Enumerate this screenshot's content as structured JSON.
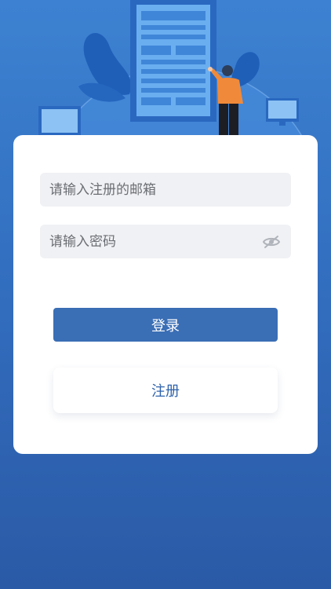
{
  "login_form": {
    "email": {
      "placeholder": "请输入注册的邮箱",
      "value": ""
    },
    "password": {
      "placeholder": "请输入密码",
      "value": "",
      "toggle_icon": "eye-off-icon"
    },
    "login_label": "登录",
    "register_label": "注册"
  },
  "colors": {
    "background_top": "#3d82d2",
    "background_bottom": "#2a5aa6",
    "primary_button": "#3a6eb5",
    "register_text": "#2e62ab",
    "input_background": "#f0f1f4"
  }
}
